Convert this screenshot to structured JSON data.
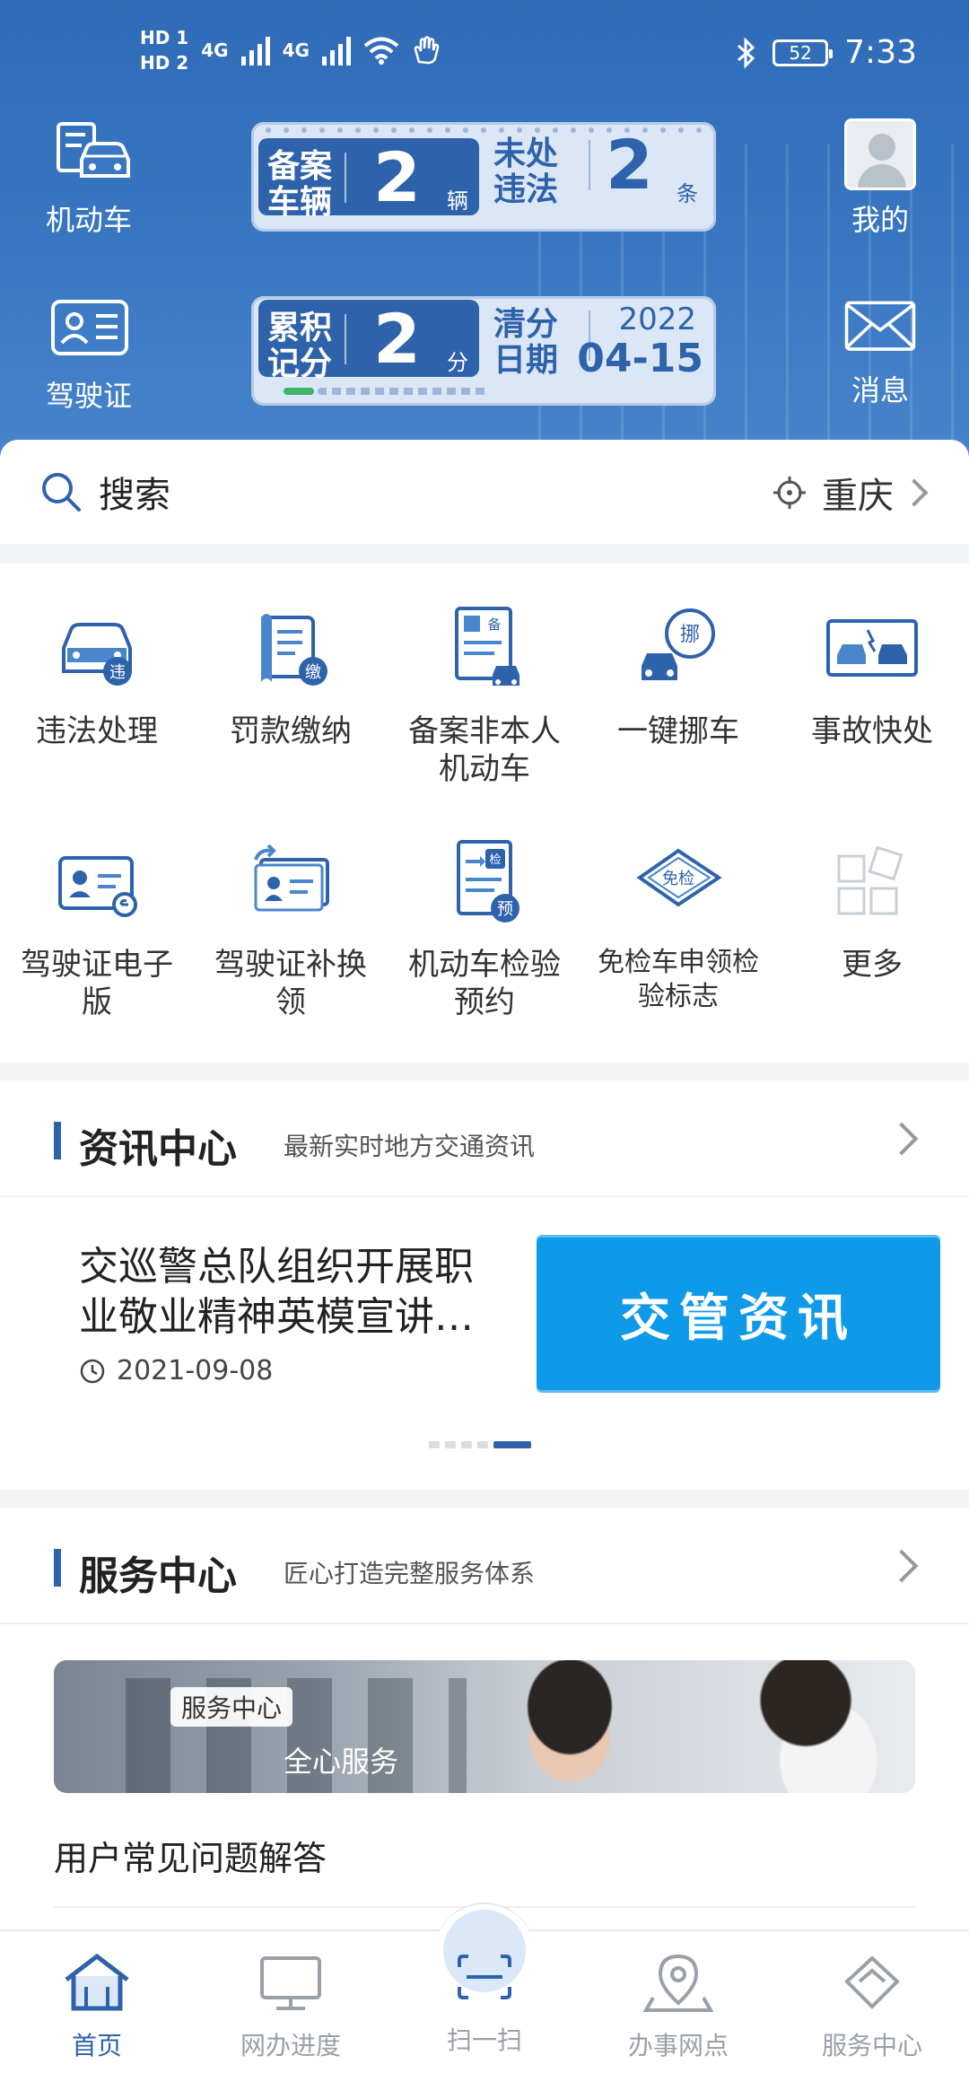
{
  "statusbar": {
    "hd1": "HD 1",
    "hd2": "HD 2",
    "net1": "4G",
    "net2": "4G",
    "battery": "52",
    "time": "7:33"
  },
  "header": {
    "vehicle_label": "机动车",
    "license_label": "驾驶证",
    "mine_label": "我的",
    "messages_label": "消息",
    "card1": {
      "left_label_1": "备案",
      "left_label_2": "车辆",
      "left_value": "2",
      "left_unit": "辆",
      "right_label_1": "未处",
      "right_label_2": "违法",
      "right_value": "2",
      "right_unit": "条"
    },
    "card2": {
      "left_label_1": "累积",
      "left_label_2": "记分",
      "left_value": "2",
      "left_unit": "分",
      "right_label_1": "清分",
      "right_label_2": "日期",
      "year": "2022",
      "date": "04-15"
    }
  },
  "search": {
    "placeholder": "搜索",
    "city": "重庆"
  },
  "services": [
    {
      "label": "违法处理",
      "badge": "违"
    },
    {
      "label": "罚款缴纳",
      "badge": "缴"
    },
    {
      "label": "备案非本人机动车",
      "badge": "备"
    },
    {
      "label": "一键挪车",
      "badge": "挪"
    },
    {
      "label": "事故快处"
    },
    {
      "label": "驾驶证电子版"
    },
    {
      "label": "驾驶证补换领"
    },
    {
      "label": "机动车检验预约",
      "badge": "检",
      "badge2": "预"
    },
    {
      "label": "免检车申领检验标志",
      "badge": "免检"
    },
    {
      "label": "更多"
    }
  ],
  "news": {
    "title": "资讯中心",
    "subtitle": "最新实时地方交通资讯",
    "headline": "交巡警总队组织开展职业敬业精神英模宣讲…",
    "date": "2021-09-08",
    "banner_text": "交管资讯"
  },
  "service_center": {
    "title": "服务中心",
    "subtitle": "匠心打造完整服务体系",
    "banner_tag": "服务中心",
    "banner_tagline": "全心服务",
    "faq": "用户常见问题解答"
  },
  "tabs": [
    {
      "label": "首页",
      "active": true
    },
    {
      "label": "网办进度"
    },
    {
      "label": "扫一扫"
    },
    {
      "label": "办事网点"
    },
    {
      "label": "服务中心"
    }
  ]
}
